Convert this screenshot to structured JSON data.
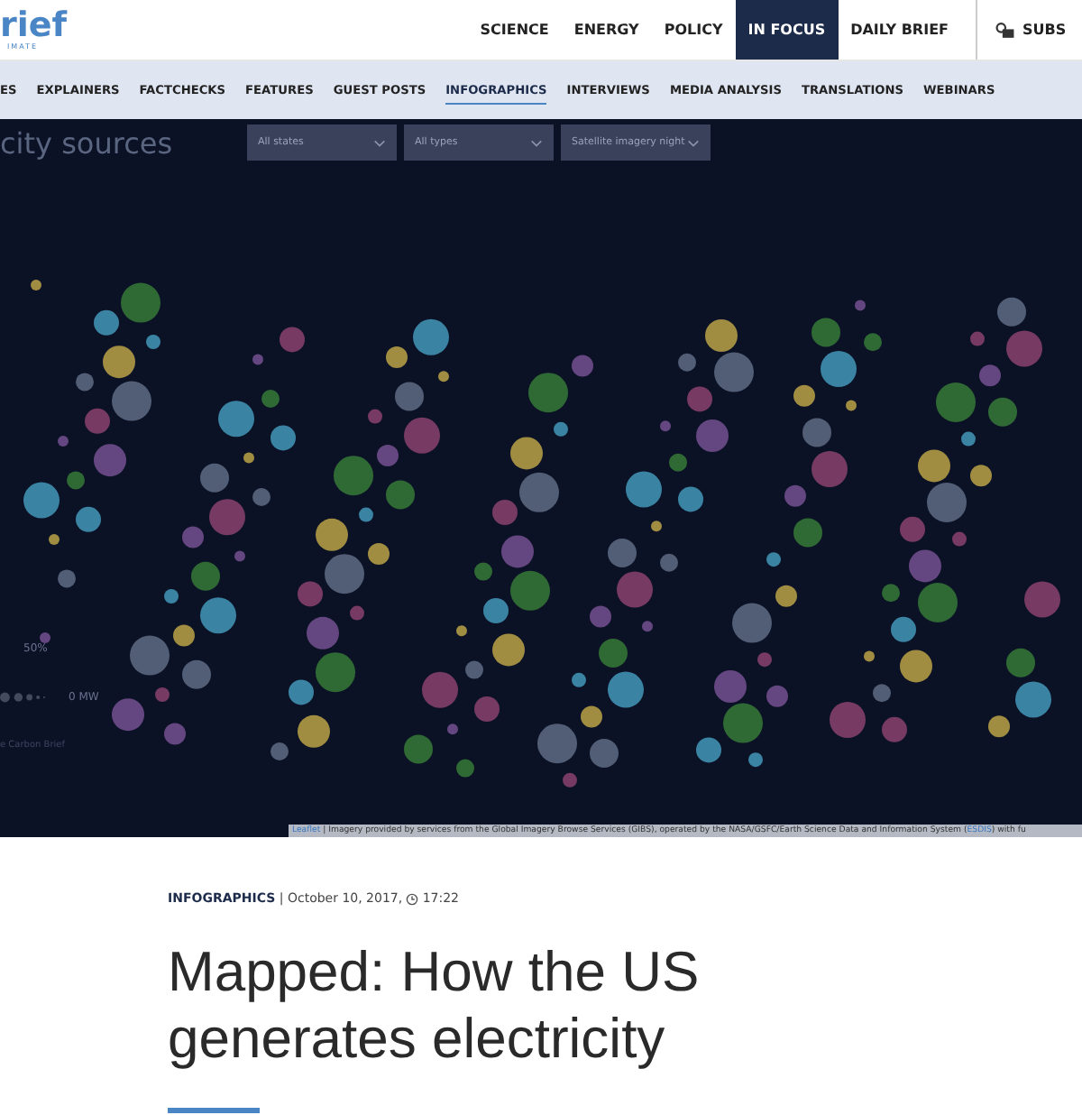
{
  "header": {
    "logo": "rief",
    "logo_sub": "IMATE",
    "nav": [
      {
        "label": "SCIENCE",
        "selected": false
      },
      {
        "label": "ENERGY",
        "selected": false
      },
      {
        "label": "POLICY",
        "selected": false
      },
      {
        "label": "IN FOCUS",
        "selected": true
      },
      {
        "label": "DAILY BRIEF",
        "selected": false
      }
    ],
    "subscribe": "SUBS"
  },
  "subnav": [
    {
      "label": "ES",
      "selected": false
    },
    {
      "label": "EXPLAINERS",
      "selected": false
    },
    {
      "label": "FACTCHECKS",
      "selected": false
    },
    {
      "label": "FEATURES",
      "selected": false
    },
    {
      "label": "GUEST POSTS",
      "selected": false
    },
    {
      "label": "INFOGRAPHICS",
      "selected": true
    },
    {
      "label": "INTERVIEWS",
      "selected": false
    },
    {
      "label": "MEDIA ANALYSIS",
      "selected": false
    },
    {
      "label": "TRANSLATIONS",
      "selected": false
    },
    {
      "label": "WEBINARS",
      "selected": false
    }
  ],
  "map": {
    "title": "city sources",
    "filters": [
      "All states",
      "All types",
      "Satellite imagery night"
    ],
    "legend_percent": "50%",
    "legend_mw": "0 MW",
    "credit": "e Carbon Brief",
    "attribution": {
      "link": "Leaflet",
      "text": " | Imagery provided by services from the Global Imagery Browse Services (GIBS), operated by the NASA/GSFC/Earth Science Data and Information System (",
      "link2": "ESDIS",
      "tail": ") with fu"
    }
  },
  "article": {
    "category": "INFOGRAPHICS",
    "date": " | October 10, 2017, ",
    "time": "17:22",
    "title": "Mapped: How the US generates electricity"
  }
}
